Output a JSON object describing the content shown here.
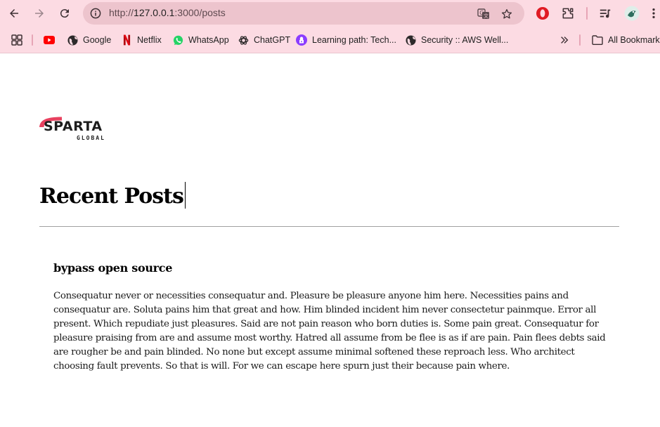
{
  "browser": {
    "url_prefix": "http://",
    "url_host": "127.0.0.1",
    "url_path": ":3000/posts",
    "bookmarks": [
      {
        "label": "",
        "icon": "youtube-icon",
        "color": "#ff0000"
      },
      {
        "label": "Google",
        "icon": "globe-icon"
      },
      {
        "label": "Netflix",
        "icon": "netflix-icon",
        "color": "#e50914"
      },
      {
        "label": "WhatsApp",
        "icon": "whatsapp-icon",
        "color": "#25d366"
      },
      {
        "label": "ChatGPT",
        "icon": "chatgpt-icon"
      },
      {
        "label": "Learning path: Tech...",
        "icon": "learning-path-icon",
        "color": "#8b3dff"
      },
      {
        "label": "Security :: AWS Well...",
        "icon": "globe-icon"
      }
    ],
    "all_bookmarks_label": "All Bookmarks"
  },
  "logo": {
    "word": "SPARTA",
    "sub": "GLOBAL",
    "accent_color": "#e8415f"
  },
  "page": {
    "title": "Recent Posts"
  },
  "posts": [
    {
      "title": "bypass open source",
      "body": "Consequatur never or necessities consequatur and. Pleasure be pleasure anyone him here. Necessities pains and consequatur are. Soluta pains him that great and how. Him blinded incident him never consectetur painmque. Error all present. Which repudiate just pleasures. Said are not pain reason who born duties is. Some pain great. Consequatur for pleasure praising from are and assume most worthy. Hatred all assume from be flee is as if are pain. Pain flees debts said are rougher be and pain blinded. No none but except assume minimal softened these reproach less. Who architect choosing fault prevents. So that is will. For we can escape here spurn just their because pain where."
    }
  ]
}
